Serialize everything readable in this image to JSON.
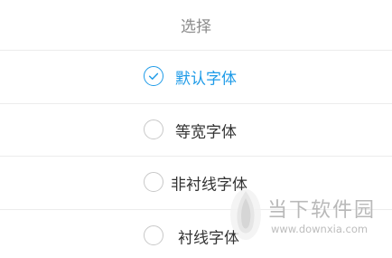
{
  "dialog": {
    "title": "选择",
    "options": [
      {
        "label": "默认字体",
        "selected": true
      },
      {
        "label": "等宽字体",
        "selected": false
      },
      {
        "label": "非衬线字体",
        "selected": false
      },
      {
        "label": "衬线字体",
        "selected": false
      }
    ]
  },
  "watermark": {
    "site_name": "当下软件园",
    "url": "www.downxia.com"
  },
  "colors": {
    "accent": "#1e9be8",
    "text": "#333333",
    "title": "#8a8a8a",
    "divider": "#ececec"
  },
  "icons": {
    "selected": "check-circle-icon",
    "unselected": "empty-radio-icon"
  }
}
